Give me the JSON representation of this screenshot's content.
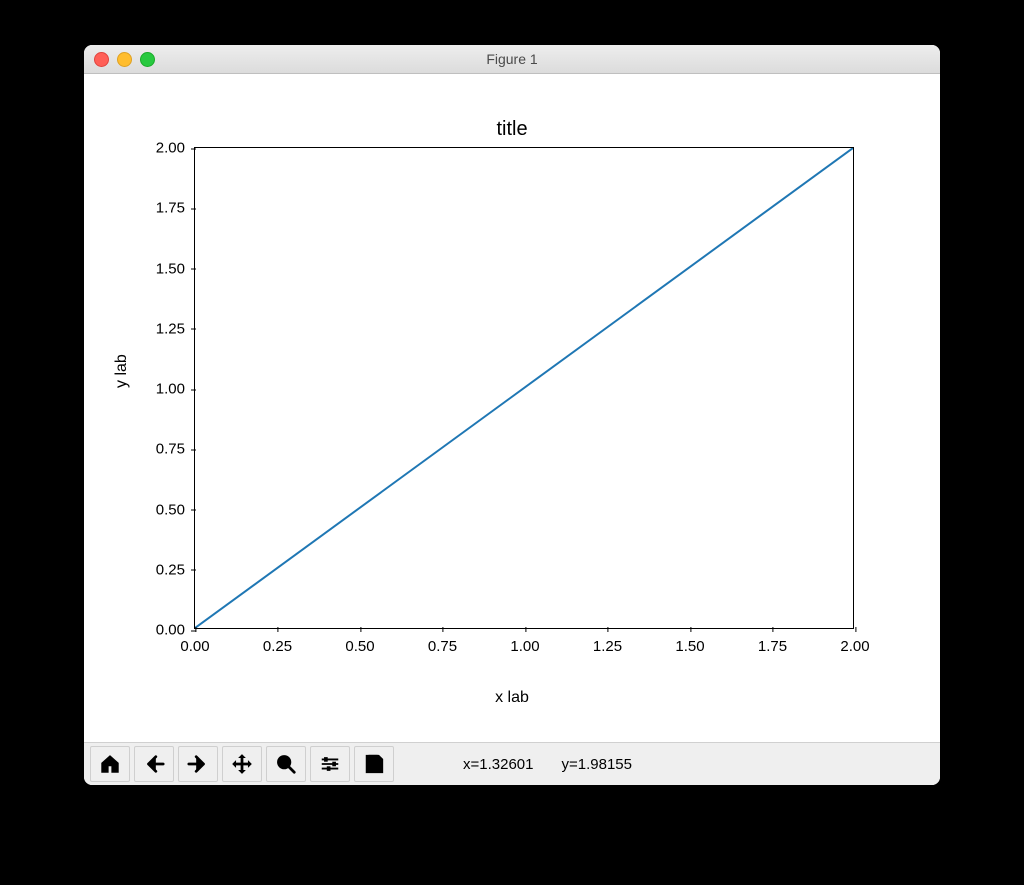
{
  "window": {
    "title": "Figure 1"
  },
  "chart_data": {
    "type": "line",
    "title": "title",
    "xlabel": "x lab",
    "ylabel": "y lab",
    "xlim": [
      0.0,
      2.0
    ],
    "ylim": [
      0.0,
      2.0
    ],
    "x": [
      0.0,
      2.0
    ],
    "values": [
      0.0,
      2.0
    ],
    "xticks": [
      "0.00",
      "0.25",
      "0.50",
      "0.75",
      "1.00",
      "1.25",
      "1.50",
      "1.75",
      "2.00"
    ],
    "yticks": [
      "0.00",
      "0.25",
      "0.50",
      "0.75",
      "1.00",
      "1.25",
      "1.50",
      "1.75",
      "2.00"
    ],
    "line_color": "#1f77b4"
  },
  "toolbar": {
    "home": "Home",
    "back": "Back",
    "forward": "Forward",
    "pan": "Pan",
    "zoom": "Zoom",
    "config": "Configure subplots",
    "save": "Save"
  },
  "status": {
    "x_label": "x=1.32601",
    "y_label": "y=1.98155"
  }
}
